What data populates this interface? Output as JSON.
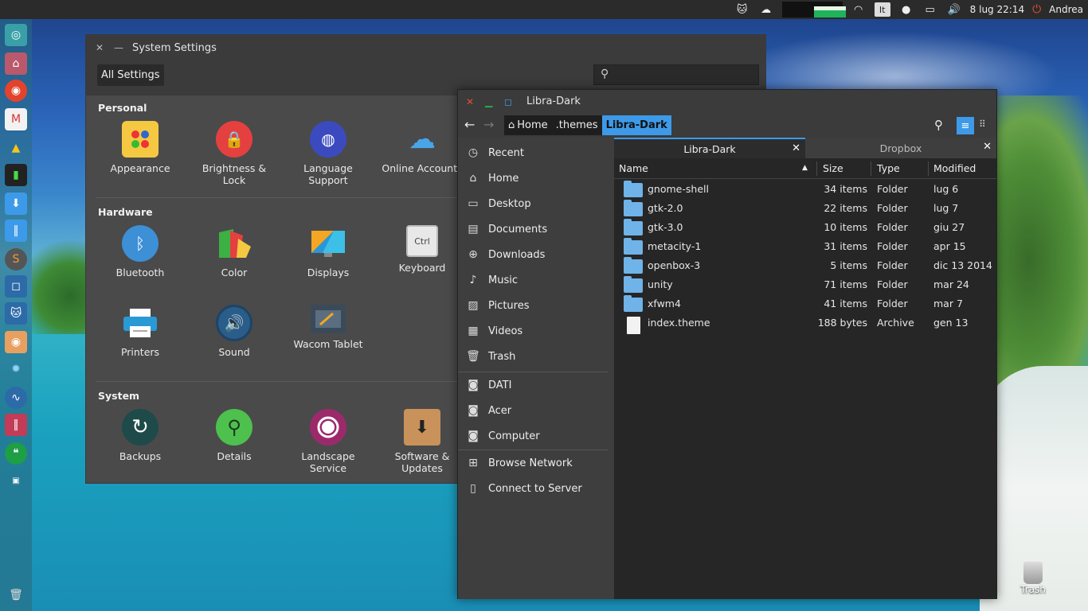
{
  "top_panel": {
    "keyboard_layout": "It",
    "clock": "8 lug 22:14",
    "user": "Andrea",
    "tray_icons": [
      "cat-icon",
      "cloud-sync-icon",
      "system-monitor-graph",
      "wifi-icon",
      "keyboard-layout-indicator",
      "chat-icon",
      "battery-icon",
      "volume-icon"
    ]
  },
  "launcher": {
    "items": [
      "ubuntu-dash-icon",
      "home-folder-icon",
      "chrome-beta-icon",
      "gmail-icon",
      "google-drive-icon",
      "terminal-icon",
      "download-icon",
      "mixer-icon",
      "skype-icon",
      "screenshot-icon",
      "cat-app-icon",
      "disk-icon",
      "settings-gear-icon",
      "system-monitor-icon",
      "equalizer-icon",
      "hangouts-icon",
      "workspace-icon"
    ],
    "trash_icon": "trash-icon"
  },
  "settings_window": {
    "title": "System Settings",
    "all_settings_label": "All Settings",
    "sections": [
      {
        "title": "Personal",
        "items": [
          {
            "label": "Appearance",
            "icon": "appearance-icon"
          },
          {
            "label": "Brightness &\nLock",
            "icon": "lock-icon"
          },
          {
            "label": "Language\nSupport",
            "icon": "globe-icon"
          },
          {
            "label": "Online Accounts",
            "icon": "cloud-icon"
          }
        ]
      },
      {
        "title": "Hardware",
        "items": [
          {
            "label": "Bluetooth",
            "icon": "bluetooth-icon"
          },
          {
            "label": "Color",
            "icon": "color-icon"
          },
          {
            "label": "Displays",
            "icon": "display-icon"
          },
          {
            "label": "Keyboard",
            "icon": "keyboard-icon"
          },
          {
            "label": "Printers",
            "icon": "printer-icon"
          },
          {
            "label": "Sound",
            "icon": "sound-icon"
          },
          {
            "label": "Wacom Tablet",
            "icon": "tablet-icon"
          }
        ]
      },
      {
        "title": "System",
        "items": [
          {
            "label": "Backups",
            "icon": "backup-icon"
          },
          {
            "label": "Details",
            "icon": "details-icon"
          },
          {
            "label": "Landscape\nService",
            "icon": "landscape-icon"
          },
          {
            "label": "Software &\nUpdates",
            "icon": "software-icon"
          }
        ]
      }
    ]
  },
  "files_window": {
    "title": "Libra-Dark",
    "breadcrumbs": [
      {
        "label": "Home"
      },
      {
        "label": ".themes"
      },
      {
        "label": "Libra-Dark"
      }
    ],
    "places": [
      {
        "label": "Recent",
        "icon": "clock-icon"
      },
      {
        "label": "Home",
        "icon": "home-icon"
      },
      {
        "label": "Desktop",
        "icon": "desktop-icon"
      },
      {
        "label": "Documents",
        "icon": "document-icon"
      },
      {
        "label": "Downloads",
        "icon": "download-icon"
      },
      {
        "label": "Music",
        "icon": "music-icon"
      },
      {
        "label": "Pictures",
        "icon": "picture-icon"
      },
      {
        "label": "Videos",
        "icon": "video-icon"
      },
      {
        "label": "Trash",
        "icon": "trash-icon"
      }
    ],
    "devices": [
      {
        "label": "DATI",
        "icon": "drive-icon"
      },
      {
        "label": "Acer",
        "icon": "drive-icon"
      },
      {
        "label": "Computer",
        "icon": "drive-icon"
      }
    ],
    "network": [
      {
        "label": "Browse Network",
        "icon": "network-icon"
      },
      {
        "label": "Connect to Server",
        "icon": "server-icon"
      }
    ],
    "tabs": [
      {
        "label": "Libra-Dark",
        "active": true
      },
      {
        "label": "Dropbox",
        "active": false
      }
    ],
    "columns": {
      "name": "Name",
      "size": "Size",
      "type": "Type",
      "modified": "Modified"
    },
    "rows": [
      {
        "name": "gnome-shell",
        "size": "34 items",
        "type": "Folder",
        "modified": "lug 6",
        "kind": "folder"
      },
      {
        "name": "gtk-2.0",
        "size": "22 items",
        "type": "Folder",
        "modified": "lug 7",
        "kind": "folder"
      },
      {
        "name": "gtk-3.0",
        "size": "10 items",
        "type": "Folder",
        "modified": "giu 27",
        "kind": "folder"
      },
      {
        "name": "metacity-1",
        "size": "31 items",
        "type": "Folder",
        "modified": "apr 15",
        "kind": "folder"
      },
      {
        "name": "openbox-3",
        "size": "5 items",
        "type": "Folder",
        "modified": "dic 13 2014",
        "kind": "folder"
      },
      {
        "name": "unity",
        "size": "71 items",
        "type": "Folder",
        "modified": "mar 24",
        "kind": "folder"
      },
      {
        "name": "xfwm4",
        "size": "41 items",
        "type": "Folder",
        "modified": "mar 7",
        "kind": "folder"
      },
      {
        "name": "index.theme",
        "size": "188 bytes",
        "type": "Archive",
        "modified": "gen 13",
        "kind": "file"
      }
    ]
  },
  "desktop": {
    "trash_label": "Trash"
  },
  "colors": {
    "accent": "#3d9ae8",
    "panel": "#2b2b2b",
    "window_bg": "#4a4a4a",
    "sidebar_bg": "#3e3e3e",
    "content_bg": "#262626",
    "close_red": "#e2502f",
    "minimize_green": "#27b24a",
    "maximize_blue": "#3d9ae8"
  }
}
